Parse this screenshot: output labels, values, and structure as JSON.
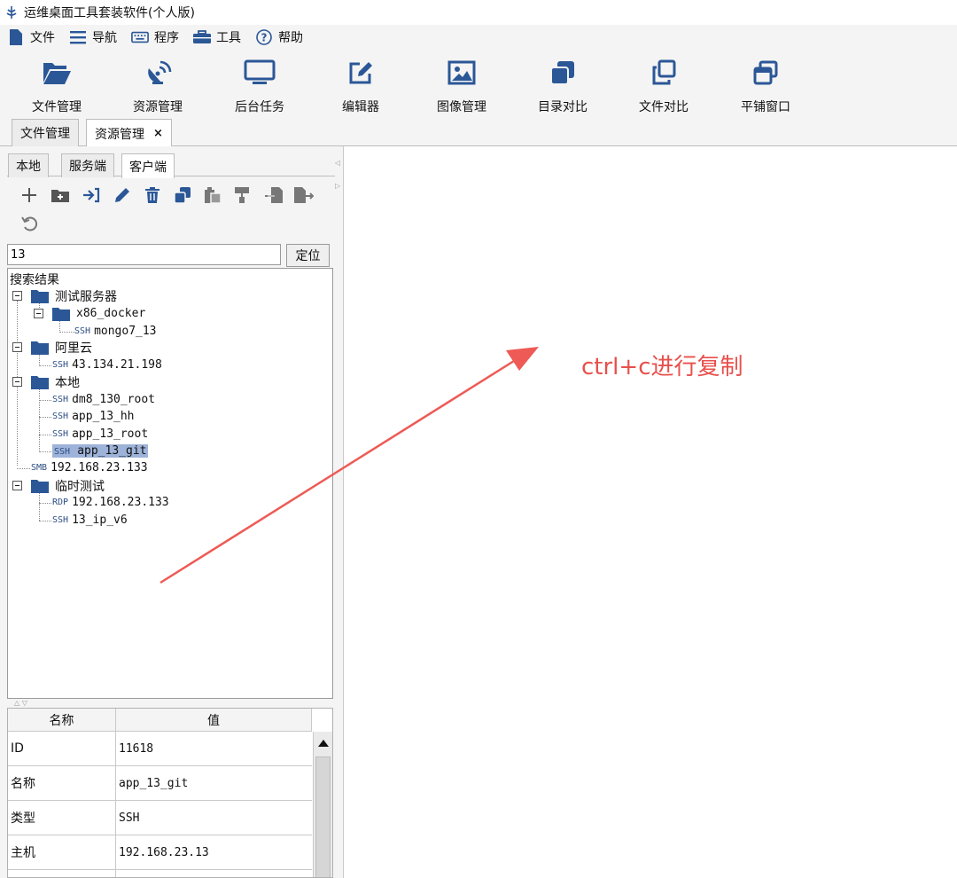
{
  "window": {
    "title": "运维桌面工具套装软件(个人版)",
    "icon": "app-logo-icon"
  },
  "menubar": [
    {
      "label": "文件",
      "icon": "file-icon"
    },
    {
      "label": "导航",
      "icon": "hamburger-icon"
    },
    {
      "label": "程序",
      "icon": "keyboard-icon"
    },
    {
      "label": "工具",
      "icon": "toolbox-icon"
    },
    {
      "label": "帮助",
      "icon": "help-circle-icon"
    }
  ],
  "toolbar": [
    {
      "label": "文件管理",
      "icon": "folder-open-icon"
    },
    {
      "label": "资源管理",
      "icon": "satellite-icon"
    },
    {
      "label": "后台任务",
      "icon": "monitor-icon"
    },
    {
      "label": "编辑器",
      "icon": "edit-icon"
    },
    {
      "label": "图像管理",
      "icon": "image-icon"
    },
    {
      "label": "目录对比",
      "icon": "copy-filled-icon"
    },
    {
      "label": "文件对比",
      "icon": "copy-outline-icon"
    },
    {
      "label": "平铺窗口",
      "icon": "tile-window-icon"
    }
  ],
  "main_tabs": [
    {
      "label": "文件管理"
    },
    {
      "label": "资源管理",
      "close": "×"
    }
  ],
  "sub_tabs": [
    {
      "label": "本地"
    },
    {
      "label": "服务端"
    },
    {
      "label": "客户端"
    }
  ],
  "action_icons": [
    "plus-icon",
    "add-folder-icon",
    "import-icon",
    "pencil-icon",
    "trash-icon",
    "duplicate-icon",
    "paste-icon",
    "paint-icon",
    "move-in-icon",
    "move-out-icon",
    "undo-icon"
  ],
  "search": {
    "value": "13",
    "button": "定位"
  },
  "tree": {
    "root": "搜索结果",
    "nodes": [
      {
        "label": "测试服务器"
      },
      {
        "label": "x86_docker"
      },
      {
        "tag": "SSH",
        "label": "mongo7_13"
      },
      {
        "label": "阿里云"
      },
      {
        "tag": "SSH",
        "label": "43.134.21.198"
      },
      {
        "label": "本地"
      },
      {
        "tag": "SSH",
        "label": "dm8_130_root"
      },
      {
        "tag": "SSH",
        "label": "app_13_hh"
      },
      {
        "tag": "SSH",
        "label": "app_13_root"
      },
      {
        "tag": "SSH",
        "label": "app_13_git"
      },
      {
        "tag": "SMB",
        "label": "192.168.23.133"
      },
      {
        "label": "临时测试"
      },
      {
        "tag": "RDP",
        "label": "192.168.23.133"
      },
      {
        "tag": "SSH",
        "label": "13_ip_v6"
      }
    ]
  },
  "props": {
    "headers": [
      "名称",
      "值"
    ],
    "rows": [
      {
        "k": "ID",
        "v": "11618"
      },
      {
        "k": "名称",
        "v": "app_13_git"
      },
      {
        "k": "类型",
        "v": "SSH"
      },
      {
        "k": "主机",
        "v": "192.168.23.13"
      }
    ]
  },
  "annotation": {
    "text": "ctrl+c进行复制",
    "color": "#e8504c"
  },
  "colors": {
    "accent": "#2b5797",
    "selection": "#9eb3d9",
    "annotation": "#e8504c"
  }
}
